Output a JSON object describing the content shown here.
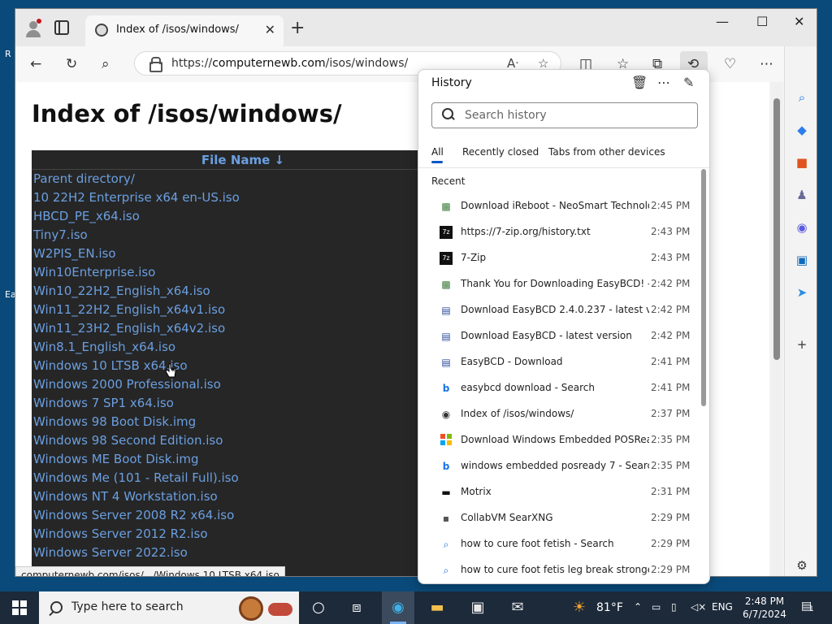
{
  "browser": {
    "tab_title": "Index of /isos/windows/",
    "url_prefix": "https://",
    "url_host": "computernewb.com",
    "url_path": "/isos/windows/",
    "status_url": "computernewb.com/isos/.../Windows 10 LTSB x64.iso"
  },
  "page": {
    "heading": "Index of /isos/windows/",
    "column_header": "File Name  ↓",
    "files": [
      "Parent directory/",
      "10 22H2 Enterprise x64 en-US.iso",
      "HBCD_PE_x64.iso",
      "Tiny7.iso",
      "W2PIS_EN.iso",
      "Win10Enterprise.iso",
      "Win10_22H2_English_x64.iso",
      "Win11_22H2_English_x64v1.iso",
      "Win11_23H2_English_x64v2.iso",
      "Win8.1_English_x64.iso",
      "Windows 10 LTSB x64.iso",
      "Windows 2000 Professional.iso",
      "Windows 7 SP1 x64.iso",
      "Windows 98 Boot Disk.img",
      "Windows 98 Second Edition.iso",
      "Windows ME Boot Disk.img",
      "Windows Me (101 - Retail Full).iso",
      "Windows NT 4 Workstation.iso",
      "Windows Server 2008 R2 x64.iso",
      "Windows Server 2012 R2.iso",
      "Windows Server 2022.iso"
    ]
  },
  "history": {
    "title": "History",
    "search_placeholder": "Search history",
    "tabs": [
      "All",
      "Recently closed",
      "Tabs from other devices"
    ],
    "section": "Recent",
    "items": [
      {
        "name": "Download iReboot - NeoSmart Technolog...",
        "time": "2:45 PM",
        "icon": "neosmart-icon"
      },
      {
        "name": "https://7-zip.org/history.txt",
        "time": "2:43 PM",
        "icon": "7zip-icon"
      },
      {
        "name": "7-Zip",
        "time": "2:43 PM",
        "icon": "7zip-icon"
      },
      {
        "name": "Thank You for Downloading EasyBCD! - N...",
        "time": "2:42 PM",
        "icon": "neosmart-icon"
      },
      {
        "name": "Download EasyBCD 2.4.0.237 - latest versi...",
        "time": "2:42 PM",
        "icon": "easybcd-icon"
      },
      {
        "name": "Download EasyBCD - latest version",
        "time": "2:42 PM",
        "icon": "easybcd-icon"
      },
      {
        "name": "EasyBCD - Download",
        "time": "2:41 PM",
        "icon": "easybcd-icon"
      },
      {
        "name": "easybcd download - Search",
        "time": "2:41 PM",
        "icon": "bing-icon"
      },
      {
        "name": "Index of /isos/windows/",
        "time": "2:37 PM",
        "icon": "computernewb-icon"
      },
      {
        "name": "Download Windows Embedded POSRead...",
        "time": "2:35 PM",
        "icon": "microsoft-icon"
      },
      {
        "name": "windows embedded posready 7 - Search",
        "time": "2:35 PM",
        "icon": "bing-icon"
      },
      {
        "name": "Motrix",
        "time": "2:31 PM",
        "icon": "motrix-icon"
      },
      {
        "name": "CollabVM SearXNG",
        "time": "2:29 PM",
        "icon": "searxng-icon"
      },
      {
        "name": "how to cure foot fetish - Search",
        "time": "2:29 PM",
        "icon": "search-icon"
      },
      {
        "name": "how to cure foot fetis leg break stronger ...",
        "time": "2:29 PM",
        "icon": "search-icon"
      }
    ]
  },
  "taskbar": {
    "search_placeholder": "Type here to search",
    "weather": "81°F",
    "language": "ENG",
    "time": "2:48 PM",
    "date": "6/7/2024",
    "notifications": "1"
  },
  "colors": {
    "link": "#6b9fe0",
    "accent": "#0b57c2",
    "listing_bg": "#262626"
  }
}
